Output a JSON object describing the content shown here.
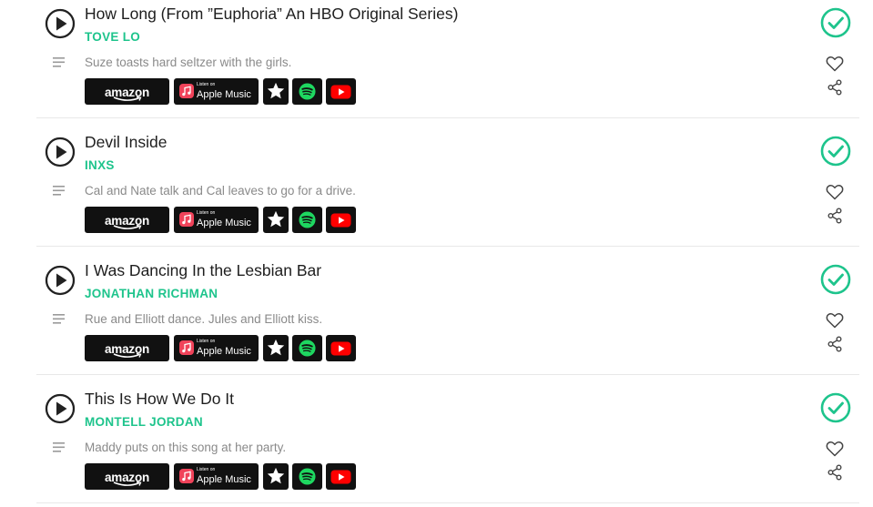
{
  "tracks": [
    {
      "title": "How Long (From ”Euphoria” An HBO Original Series)",
      "artist": "TOVE LO",
      "scene": "Suze toasts hard seltzer with the girls."
    },
    {
      "title": "Devil Inside",
      "artist": "INXS",
      "scene": "Cal and Nate talk and Cal leaves to go for a drive."
    },
    {
      "title": "I Was Dancing In the Lesbian Bar",
      "artist": "JONATHAN RICHMAN",
      "scene": "Rue and Elliott dance. Jules and Elliott kiss."
    },
    {
      "title": "This Is How We Do It",
      "artist": "MONTELL JORDAN",
      "scene": "Maddy puts on this song at her party."
    }
  ],
  "services": {
    "amazon_label": "amazon",
    "apple_small": "Listen on",
    "apple_big": "Apple Music"
  },
  "icons": {
    "play": "play-icon",
    "menu": "scene-menu-icon",
    "check": "check-icon",
    "heart": "heart-icon",
    "share": "share-icon",
    "star": "star-icon",
    "spotify": "spotify-icon",
    "youtube": "youtube-icon"
  },
  "colors": {
    "accent": "#1ec48c",
    "scene_text": "#8a8a8a",
    "button_bg": "#111111",
    "spotify": "#1ed760",
    "youtube": "#ff0000",
    "apple": "#f0435a"
  }
}
